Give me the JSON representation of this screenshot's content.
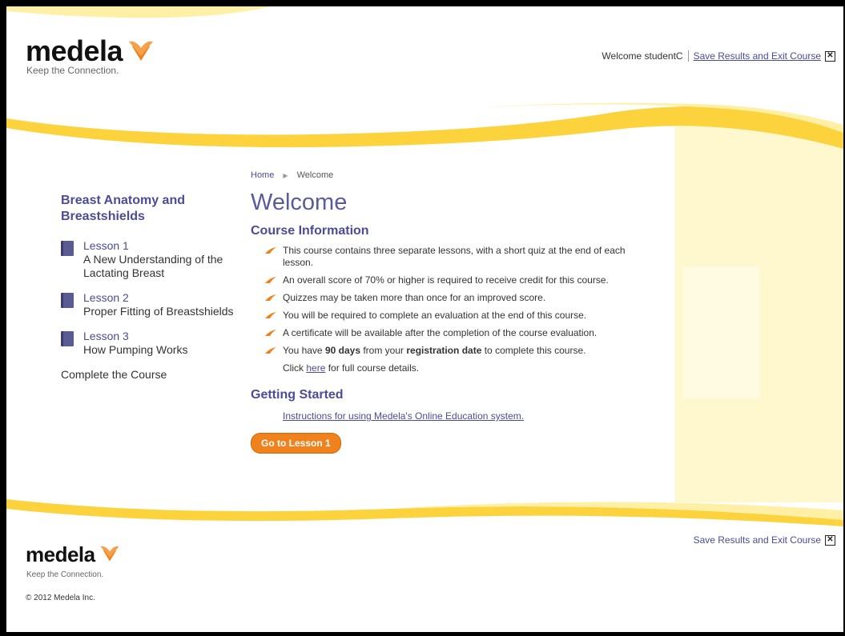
{
  "header": {
    "brand": "medela",
    "tagline": "Keep the Connection.",
    "welcome": "Welcome studentC",
    "exit_link": "Save Results and Exit Course",
    "close_glyph": "✕"
  },
  "sidebar": {
    "heading": "Breast Anatomy and Breastshields",
    "lessons": [
      {
        "number": "Lesson 1",
        "title": "A New Understanding of the Lactating Breast"
      },
      {
        "number": "Lesson 2",
        "title": "Proper Fitting of Breastshields"
      },
      {
        "number": "Lesson 3",
        "title": "How Pumping Works"
      }
    ],
    "complete": "Complete the Course"
  },
  "breadcrumb": {
    "home": "Home",
    "current": "Welcome"
  },
  "main": {
    "title": "Welcome",
    "course_info_heading": "Course Information",
    "bullets": [
      "This course contains three separate lessons, with a short quiz at the end of each lesson.",
      "An overall score of 70% or higher is required to receive credit for this course.",
      "Quizzes may be taken more than once for an improved score.",
      "You will be required to complete an evaluation at the end of this course.",
      "A certificate will be available after the completion of the course evaluation."
    ],
    "last_bullet": {
      "pre": "You have ",
      "days": "90 days",
      "mid": " from your ",
      "reg": "registration date",
      "post": " to complete this course."
    },
    "click": {
      "pre": "Click ",
      "link": "here",
      "post": " for full course details."
    },
    "getting_started_heading": "Getting Started",
    "instructions_link": "Instructions for using Medela's Online Education system.",
    "go_button": "Go to Lesson 1"
  },
  "footer": {
    "brand": "medela",
    "tagline": "Keep the Connection.",
    "exit_link": "Save Results and Exit Course",
    "copyright": "© 2012 Medela Inc."
  },
  "colors": {
    "accent_purple": "#4b4b9a",
    "wave_yellow": "#fcd33d",
    "wave_light": "#fff0a6",
    "brand_orange": "#f0821e"
  },
  "icons": {
    "logo": "medela-flower-icon",
    "lesson": "book-icon",
    "bullet": "orange-arrow-bullet-icon",
    "close": "close-box-icon"
  }
}
